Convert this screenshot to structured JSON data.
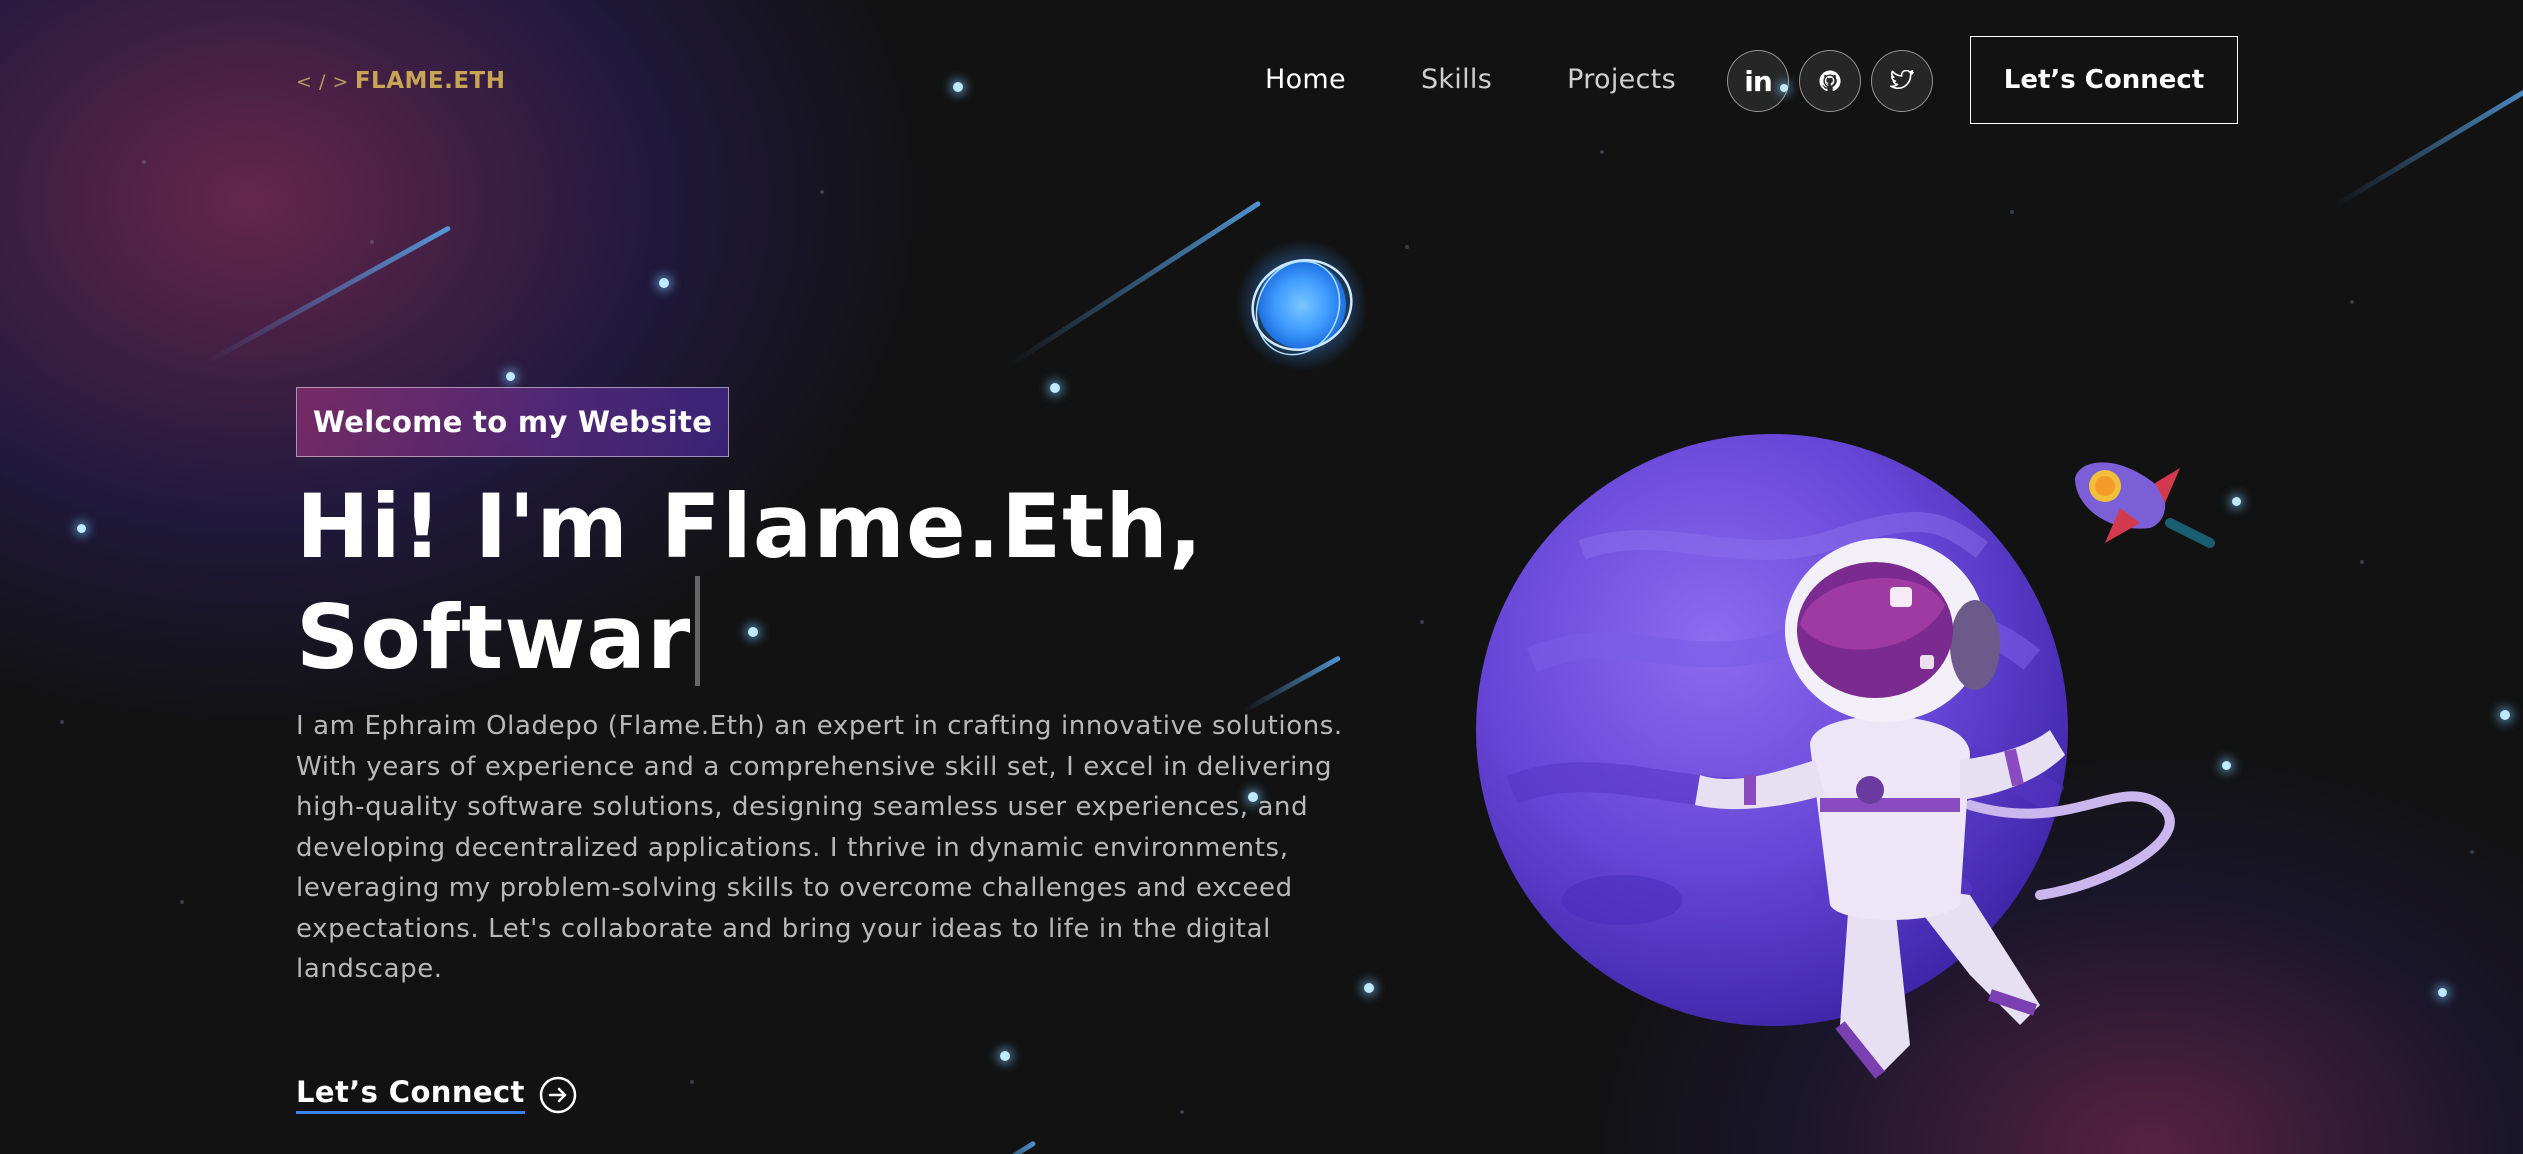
{
  "brand": {
    "code_glyph": "< / >",
    "name": "FLAME.ETH"
  },
  "nav": {
    "links": [
      {
        "label": "Home"
      },
      {
        "label": "Skills"
      },
      {
        "label": "Projects"
      }
    ],
    "socials": [
      {
        "icon": "linkedin-icon",
        "label": "in"
      },
      {
        "icon": "github-icon"
      },
      {
        "icon": "twitter-icon"
      }
    ],
    "connect_label": "Let’s Connect"
  },
  "banner": {
    "tagline": "Welcome to my Website",
    "headline_line1": "Hi! I'm Flame.Eth,",
    "headline_line2": "Softwar",
    "bio": "I am Ephraim Oladepo (Flame.Eth) an expert in crafting innovative solutions. With years of experience and a comprehensive skill set, I excel in delivering high-quality software solutions, designing seamless user experiences, and developing decentralized applications. I thrive in dynamic environments, leveraging my problem-solving skills to overcome challenges and exceed expectations. Let's collaborate and bring your ideas to life in the digital landscape.",
    "cta_label": "Let’s Connect"
  },
  "theme": {
    "background": "#121212",
    "accent_gradient_start": "#AA367C",
    "accent_gradient_end": "#4A2FBD",
    "brand_gold": "#C8A455",
    "link_underline": "#3B82F6"
  }
}
